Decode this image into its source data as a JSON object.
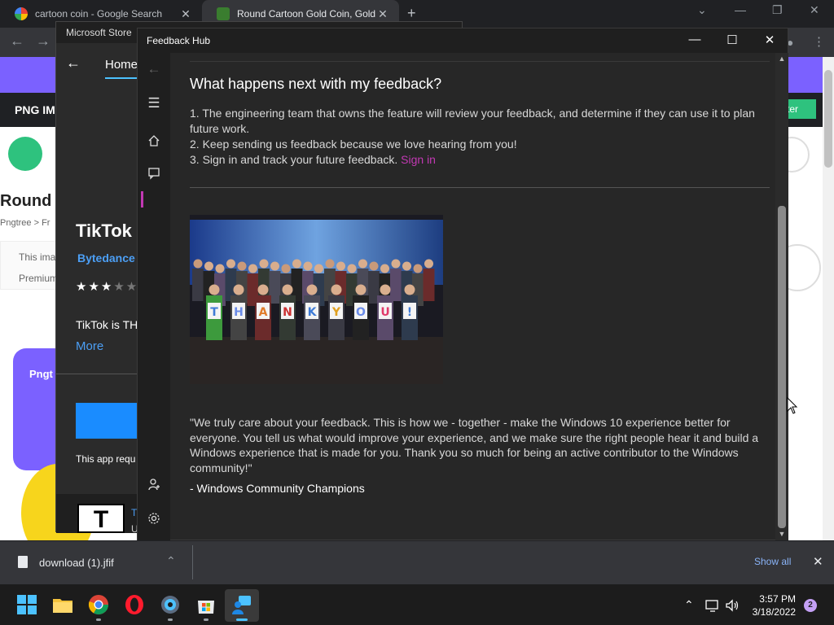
{
  "chrome": {
    "tabs": [
      {
        "title": "cartoon coin - Google Search",
        "icon": "google-icon"
      },
      {
        "title": "Round Cartoon Gold Coin, Gold C",
        "icon": "pngtree-icon"
      }
    ],
    "page": {
      "bar_label": "PNG IM",
      "register_label": "ster",
      "heading": "Round",
      "crumb": "Pngtree > Fr",
      "note_line1": "This ima",
      "note_line2": "Premium",
      "card_label": "Pngt"
    }
  },
  "store": {
    "title": "Microsoft Store",
    "home_label": "Home",
    "app_title": "TikTok",
    "developer": "Bytedance",
    "rating_stars": 3,
    "description": "TikTok is TH",
    "more_label": "More",
    "requirements": "This app requ",
    "esrb_letter": "T",
    "esrb_text": "T",
    "esrb_sub": "U"
  },
  "feedback_hub": {
    "title": "Feedback Hub",
    "heading": "What happens next with my feedback?",
    "step1": "1. The engineering team that owns the feature will review your feedback, and determine if they can use it to plan future work.",
    "step2": "2. Keep sending us feedback because we love hearing from you!",
    "step3": "3. Sign in and track your future feedback.",
    "sign_in_link": "Sign in",
    "photo_letters": [
      "T",
      "H",
      "A",
      "N",
      "K",
      "Y",
      "O",
      "U",
      "!"
    ],
    "quote": "\"We truly care about your feedback. This is how we - together - make the Windows 10 experience better for everyone. You tell us what would improve your experience, and we make sure the right people hear it and build a Windows experience that is made for you. Thank you so much for being an active contributor to the Windows community!\"",
    "signature": "- Windows Community Champions",
    "accent": "#c239b3"
  },
  "downloads": {
    "file_name": "download (1).jfif",
    "show_all": "Show all"
  },
  "taskbar": {
    "time": "3:57 PM",
    "date": "3/18/2022",
    "notification_count": "2"
  }
}
